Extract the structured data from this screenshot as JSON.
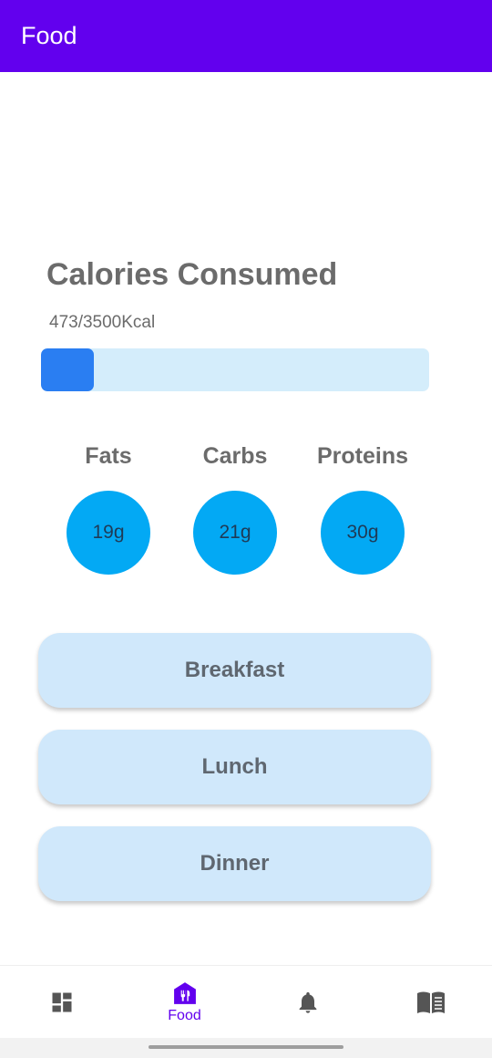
{
  "app_bar": {
    "title": "Food"
  },
  "calories": {
    "title": "Calories Consumed",
    "value_text": "473/3500Kcal",
    "progress_fraction": 0.135
  },
  "macros": [
    {
      "label": "Fats",
      "value": "19g"
    },
    {
      "label": "Carbs",
      "value": "21g"
    },
    {
      "label": "Proteins",
      "value": "30g"
    }
  ],
  "meals": [
    {
      "label": "Breakfast"
    },
    {
      "label": "Lunch"
    },
    {
      "label": "Dinner"
    }
  ],
  "bottom_nav": {
    "items": [
      {
        "icon": "dashboard-icon",
        "label": ""
      },
      {
        "icon": "restaurant-icon",
        "label": "Food",
        "active": true
      },
      {
        "icon": "notifications-icon",
        "label": ""
      },
      {
        "icon": "book-icon",
        "label": ""
      }
    ]
  },
  "colors": {
    "primary": "#6200EE",
    "progress_fill": "#2A7EF2",
    "progress_track": "#D4EDFB",
    "macro_circle": "#03A9F4",
    "meal_button": "#D0E8FB",
    "nav_inactive": "#555555"
  }
}
